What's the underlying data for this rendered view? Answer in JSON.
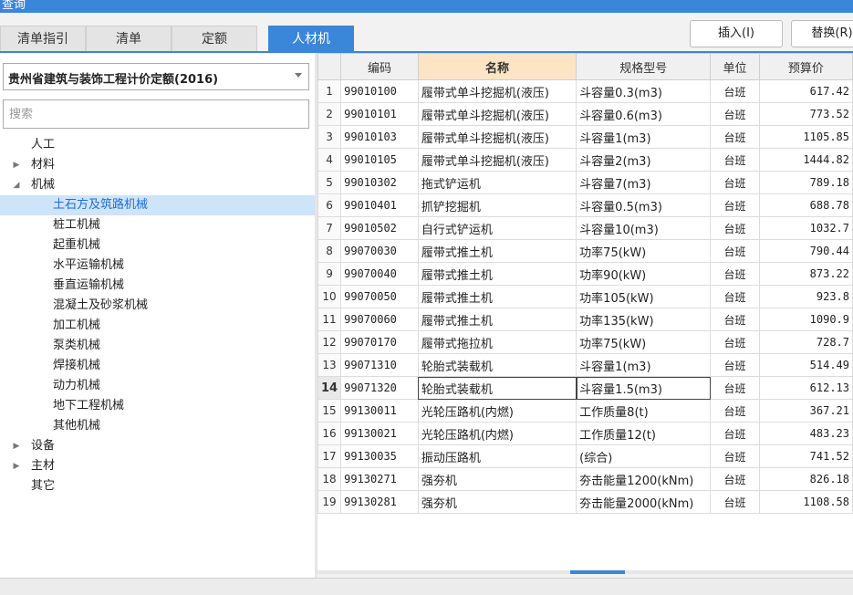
{
  "window": {
    "title": "查询"
  },
  "tabs": [
    {
      "label": "清单指引",
      "active": false
    },
    {
      "label": "清单",
      "active": false
    },
    {
      "label": "定额",
      "active": false
    },
    {
      "label": "人材机",
      "active": true
    }
  ],
  "toolbar": {
    "insert_label": "插入(I)",
    "replace_label": "替换(R)"
  },
  "left": {
    "quota_select": "贵州省建筑与装饰工程计价定额(2016)",
    "search_placeholder": "搜索",
    "tree": [
      {
        "label": "人工",
        "level": 1,
        "toggle": ""
      },
      {
        "label": "材料",
        "level": 1,
        "toggle": "collapsed"
      },
      {
        "label": "机械",
        "level": 1,
        "toggle": "expanded"
      },
      {
        "label": "土石方及筑路机械",
        "level": 2,
        "selected": true
      },
      {
        "label": "桩工机械",
        "level": 2
      },
      {
        "label": "起重机械",
        "level": 2
      },
      {
        "label": "水平运输机械",
        "level": 2
      },
      {
        "label": "垂直运输机械",
        "level": 2
      },
      {
        "label": "混凝土及砂浆机械",
        "level": 2
      },
      {
        "label": "加工机械",
        "level": 2
      },
      {
        "label": "泵类机械",
        "level": 2
      },
      {
        "label": "焊接机械",
        "level": 2
      },
      {
        "label": "动力机械",
        "level": 2
      },
      {
        "label": "地下工程机械",
        "level": 2
      },
      {
        "label": "其他机械",
        "level": 2
      },
      {
        "label": "设备",
        "level": 1,
        "toggle": "collapsed"
      },
      {
        "label": "主材",
        "level": 1,
        "toggle": "collapsed"
      },
      {
        "label": "其它",
        "level": 1,
        "toggle": ""
      }
    ]
  },
  "grid": {
    "columns": [
      "",
      "编码",
      "名称",
      "规格型号",
      "单位",
      "预算价"
    ],
    "highlight_column": "名称",
    "current_row": "14",
    "rows": [
      [
        "1",
        "99010100",
        "履带式单斗挖掘机(液压)",
        "斗容量0.3(m3)",
        "台班",
        "617.42"
      ],
      [
        "2",
        "99010101",
        "履带式单斗挖掘机(液压)",
        "斗容量0.6(m3)",
        "台班",
        "773.52"
      ],
      [
        "3",
        "99010103",
        "履带式单斗挖掘机(液压)",
        "斗容量1(m3)",
        "台班",
        "1105.85"
      ],
      [
        "4",
        "99010105",
        "履带式单斗挖掘机(液压)",
        "斗容量2(m3)",
        "台班",
        "1444.82"
      ],
      [
        "5",
        "99010302",
        "拖式铲运机",
        "斗容量7(m3)",
        "台班",
        "789.18"
      ],
      [
        "6",
        "99010401",
        "抓铲挖掘机",
        "斗容量0.5(m3)",
        "台班",
        "688.78"
      ],
      [
        "7",
        "99010502",
        "自行式铲运机",
        "斗容量10(m3)",
        "台班",
        "1032.7"
      ],
      [
        "8",
        "99070030",
        "履带式推土机",
        "功率75(kW)",
        "台班",
        "790.44"
      ],
      [
        "9",
        "99070040",
        "履带式推土机",
        "功率90(kW)",
        "台班",
        "873.22"
      ],
      [
        "10",
        "99070050",
        "履带式推土机",
        "功率105(kW)",
        "台班",
        "923.8"
      ],
      [
        "11",
        "99070060",
        "履带式推土机",
        "功率135(kW)",
        "台班",
        "1090.9"
      ],
      [
        "12",
        "99070170",
        "履带式拖拉机",
        "功率75(kW)",
        "台班",
        "728.7"
      ],
      [
        "13",
        "99071310",
        "轮胎式装载机",
        "斗容量1(m3)",
        "台班",
        "514.49"
      ],
      [
        "14",
        "99071320",
        "轮胎式装载机",
        "斗容量1.5(m3)",
        "台班",
        "612.13"
      ],
      [
        "15",
        "99130011",
        "光轮压路机(内燃)",
        "工作质量8(t)",
        "台班",
        "367.21"
      ],
      [
        "16",
        "99130021",
        "光轮压路机(内燃)",
        "工作质量12(t)",
        "台班",
        "483.23"
      ],
      [
        "17",
        "99130035",
        "振动压路机",
        "(综合)",
        "台班",
        "741.52"
      ],
      [
        "18",
        "99130271",
        "强夯机",
        "夯击能量1200(kNm)",
        "台班",
        "826.18"
      ],
      [
        "19",
        "99130281",
        "强夯机",
        "夯击能量2000(kNm)",
        "台班",
        "1108.58"
      ]
    ]
  },
  "colors": {
    "accent": "#3a86d8",
    "header_highlight": "#fce4c4",
    "selected_node": "#cde4f9"
  }
}
